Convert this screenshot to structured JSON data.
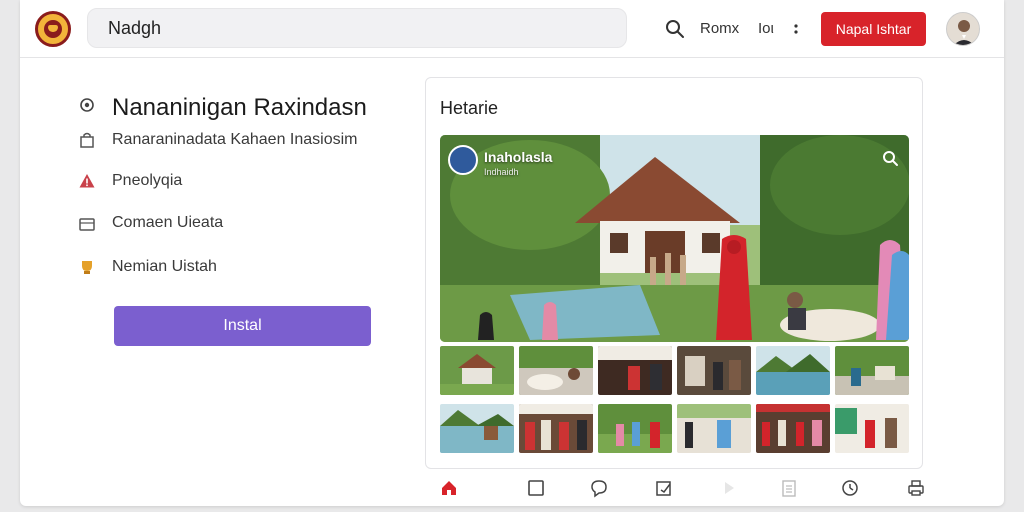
{
  "header": {
    "search_value": "Nadgh",
    "link_1": "Romx",
    "link_2": "Ιοι",
    "more_icon": "more-vertical-icon",
    "cta_label": "Napal Ishtar",
    "colors": {
      "cta": "#d8232a",
      "accent": "#7b5fcf"
    }
  },
  "left": {
    "title": "Nananinigan Raxindasn",
    "items": [
      {
        "label": "Ranaraninadata Kahaen Inasiosim",
        "icon": "bag-icon"
      },
      {
        "label": "Pneolyqia",
        "icon": "warning-icon"
      },
      {
        "label": "Comaen Uieata",
        "icon": "briefcase-icon"
      },
      {
        "label": "Nemian Uistah",
        "icon": "trophy-icon"
      }
    ],
    "install_label": "Instal"
  },
  "card": {
    "title": "Hetarie",
    "hero": {
      "title": "Inaholasla",
      "subtitle": "Indhaidh"
    }
  },
  "bottom_nav": [
    "home-icon",
    "square-icon",
    "chat-icon",
    "edit-icon",
    "play-icon",
    "document-icon",
    "clock-icon",
    "print-icon"
  ]
}
